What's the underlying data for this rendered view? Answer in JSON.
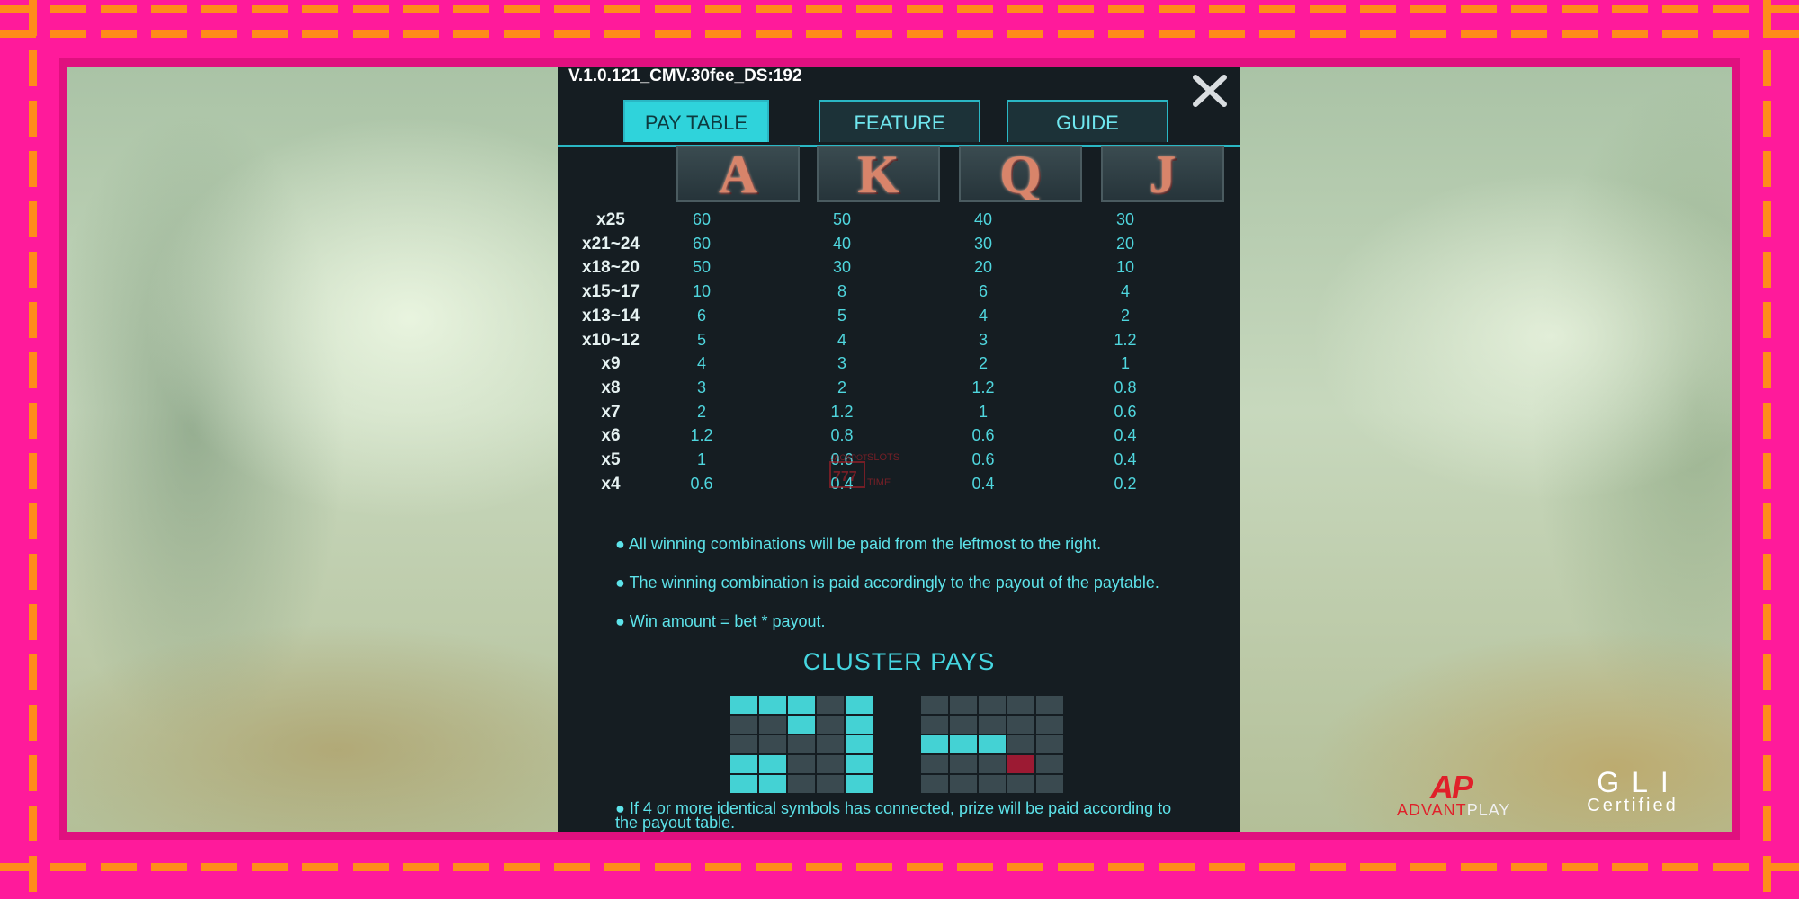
{
  "version": "V.1.0.121_CMV.30fee_DS:192",
  "tabs": [
    {
      "label": "PAY TABLE",
      "active": true
    },
    {
      "label": "FEATURE",
      "active": false
    },
    {
      "label": "GUIDE",
      "active": false
    }
  ],
  "symbols": [
    "A",
    "K",
    "Q",
    "J"
  ],
  "paytable": [
    {
      "count": "x25",
      "values": [
        "60",
        "50",
        "40",
        "30"
      ]
    },
    {
      "count": "x21~24",
      "values": [
        "60",
        "40",
        "30",
        "20"
      ]
    },
    {
      "count": "x18~20",
      "values": [
        "50",
        "30",
        "20",
        "10"
      ]
    },
    {
      "count": "x15~17",
      "values": [
        "10",
        "8",
        "6",
        "4"
      ]
    },
    {
      "count": "x13~14",
      "values": [
        "6",
        "5",
        "4",
        "2"
      ]
    },
    {
      "count": "x10~12",
      "values": [
        "5",
        "4",
        "3",
        "1.2"
      ]
    },
    {
      "count": "x9",
      "values": [
        "4",
        "3",
        "2",
        "1"
      ]
    },
    {
      "count": "x8",
      "values": [
        "3",
        "2",
        "1.2",
        "0.8"
      ]
    },
    {
      "count": "x7",
      "values": [
        "2",
        "1.2",
        "1",
        "0.6"
      ]
    },
    {
      "count": "x6",
      "values": [
        "1.2",
        "0.8",
        "0.6",
        "0.4"
      ]
    },
    {
      "count": "x5",
      "values": [
        "1",
        "0.6",
        "0.6",
        "0.4"
      ]
    },
    {
      "count": "x4",
      "values": [
        "0.6",
        "0.4",
        "0.4",
        "0.2"
      ]
    }
  ],
  "rules": [
    "● All winning combinations will be paid from the leftmost to the right.",
    "● The winning combination is paid accordingly to the payout of the paytable.",
    "● Win amount = bet * payout."
  ],
  "cluster_title": "CLUSTER PAYS",
  "cluster_rule": "● If 4 or more identical symbols has connected, prize will be paid according to the payout table.",
  "cluster_grid_left": [
    [
      1,
      1,
      1,
      0,
      1
    ],
    [
      0,
      0,
      1,
      0,
      1
    ],
    [
      0,
      0,
      0,
      0,
      1
    ],
    [
      1,
      1,
      0,
      0,
      1
    ],
    [
      1,
      1,
      0,
      0,
      1
    ]
  ],
  "cluster_grid_right": [
    [
      0,
      0,
      0,
      0,
      0
    ],
    [
      0,
      0,
      0,
      0,
      0
    ],
    [
      1,
      1,
      1,
      0,
      0
    ],
    [
      0,
      0,
      0,
      2,
      0
    ],
    [
      0,
      0,
      0,
      0,
      0
    ]
  ],
  "colors": {
    "frame": "#ff1a9b",
    "dash": "#ff8c1a",
    "panel": "#151d22",
    "accent": "#2fd3db",
    "value_text": "#4fd6de",
    "cluster_on": "#44d2d4",
    "cluster_red": "#9c1a33"
  },
  "logos": {
    "advantplay_mark": "AP",
    "advantplay_text_a": "ADVANT",
    "advantplay_text_b": "PLAY",
    "gli_main": "GLI",
    "gli_sub": "Certified"
  },
  "watermark": {
    "line1": "JACKPOT",
    "line2": "SLOTS",
    "line3": "777",
    "line4": "TIME"
  },
  "icons": {
    "close": "close-icon"
  }
}
